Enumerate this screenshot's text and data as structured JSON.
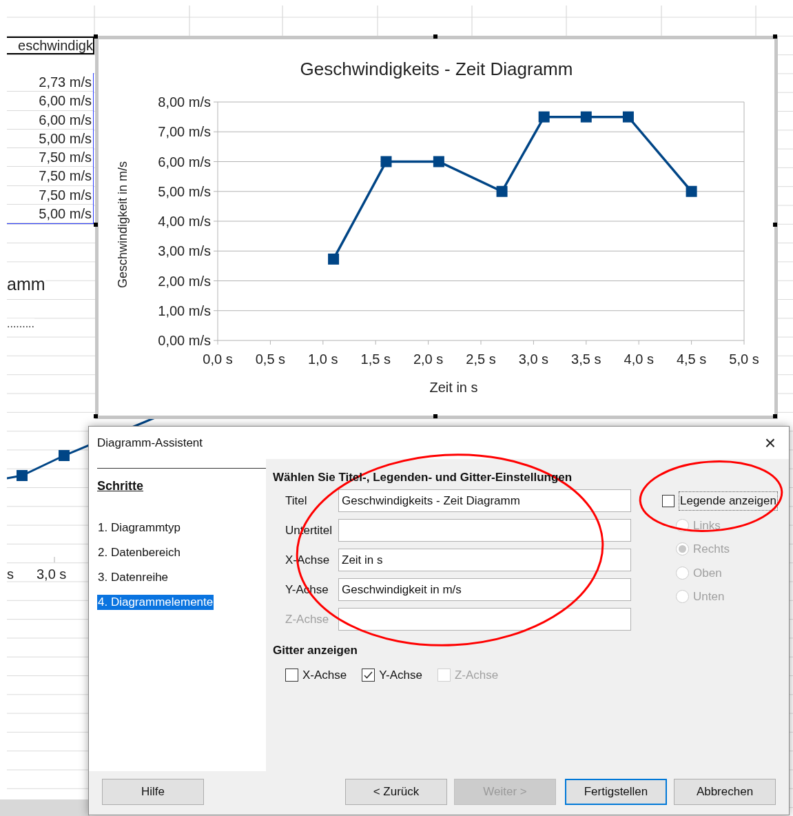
{
  "spreadsheet": {
    "header_cell": "eschwindigk",
    "cells": [
      "2,73 m/s",
      "6,00 m/s",
      "6,00 m/s",
      "5,00 m/s",
      "7,50 m/s",
      "7,50 m/s",
      "7,50 m/s",
      "5,00 m/s"
    ],
    "background_chart": {
      "title_fragment": "amm",
      "dots": ".........",
      "tick_labels": [
        "s",
        "3,0 s"
      ]
    }
  },
  "chart": {
    "chart_data": {
      "type": "line",
      "title": "Geschwindigkeits - Zeit Diagramm",
      "xlabel": "Zeit in s",
      "ylabel": "Geschwindigkeit in m/s",
      "x": [
        1.1,
        1.6,
        2.1,
        2.7,
        3.1,
        3.5,
        3.9,
        4.5
      ],
      "series": [
        {
          "color": "#004586",
          "marker": "square",
          "values": [
            2.73,
            6,
            6,
            5,
            7.5,
            7.5,
            7.5,
            5
          ]
        }
      ],
      "grid": {
        "x": false,
        "y": true
      },
      "xlim": [
        0,
        5
      ],
      "ylim": [
        0,
        8
      ],
      "xticks": [
        {
          "value": 0,
          "label": "0,0 s"
        },
        {
          "value": 0.5,
          "label": "0,5 s"
        },
        {
          "value": 1,
          "label": "1,0 s"
        },
        {
          "value": 1.5,
          "label": "1,5 s"
        },
        {
          "value": 2,
          "label": "2,0 s"
        },
        {
          "value": 2.5,
          "label": "2,5 s"
        },
        {
          "value": 3,
          "label": "3,0 s"
        },
        {
          "value": 3.5,
          "label": "3,5 s"
        },
        {
          "value": 4,
          "label": "4,0 s"
        },
        {
          "value": 4.5,
          "label": "4,5 s"
        },
        {
          "value": 5,
          "label": "5,0 s"
        }
      ],
      "yticks": [
        {
          "value": 0,
          "label": "0,00 m/s"
        },
        {
          "value": 1,
          "label": "1,00 m/s"
        },
        {
          "value": 2,
          "label": "2,00 m/s"
        },
        {
          "value": 3,
          "label": "3,00 m/s"
        },
        {
          "value": 4,
          "label": "4,00 m/s"
        },
        {
          "value": 5,
          "label": "5,00 m/s"
        },
        {
          "value": 6,
          "label": "6,00 m/s"
        },
        {
          "value": 7,
          "label": "7,00 m/s"
        },
        {
          "value": 8,
          "label": "8,00 m/s"
        }
      ]
    }
  },
  "dialog": {
    "title": "Diagramm-Assistent",
    "close": "×",
    "steps_heading": "Schritte",
    "steps": [
      {
        "label": "1. Diagrammtyp",
        "selected": false
      },
      {
        "label": "2. Datenbereich",
        "selected": false
      },
      {
        "label": "3. Datenreihe",
        "selected": false
      },
      {
        "label": "4. Diagrammelemente",
        "selected": true
      }
    ],
    "section_title": "Wählen Sie Titel-, Legenden- und Gitter-Einstellungen",
    "fields": [
      {
        "label": "Titel",
        "value": "Geschwindigkeits - Zeit Diagramm",
        "disabled": false
      },
      {
        "label": "Untertitel",
        "disabled": false
      },
      {
        "label": "X-Achse",
        "value": "Zeit in s",
        "disabled": false
      },
      {
        "label": "Y-Achse",
        "value": "Geschwindigkeit in m/s",
        "disabled": false
      },
      {
        "label": "Z-Achse",
        "disabled": true
      }
    ],
    "legend": {
      "label": "Legende anzeigen",
      "checked": false,
      "positions": [
        {
          "label": "Links",
          "selected": false
        },
        {
          "label": "Rechts",
          "selected": true
        },
        {
          "label": "Oben",
          "selected": false
        },
        {
          "label": "Unten",
          "selected": false
        }
      ]
    },
    "grid_title": "Gitter anzeigen",
    "grid": [
      {
        "label": "X-Achse",
        "checked": false,
        "disabled": false
      },
      {
        "label": "Y-Achse",
        "checked": true,
        "disabled": false
      },
      {
        "label": "Z-Achse",
        "checked": false,
        "disabled": true
      }
    ],
    "buttons": [
      {
        "label": "Hilfe",
        "kind": "normal"
      },
      {
        "label": "< Zurück",
        "kind": "normal"
      },
      {
        "label": "Weiter >",
        "kind": "disabled"
      },
      {
        "label": "Fertigstellen",
        "kind": "default"
      },
      {
        "label": "Abbrechen",
        "kind": "normal"
      }
    ]
  },
  "annotations": [
    {
      "kind": "ellipse",
      "color": "#ff0000"
    },
    {
      "kind": "ellipse",
      "color": "#ff0000"
    }
  ]
}
